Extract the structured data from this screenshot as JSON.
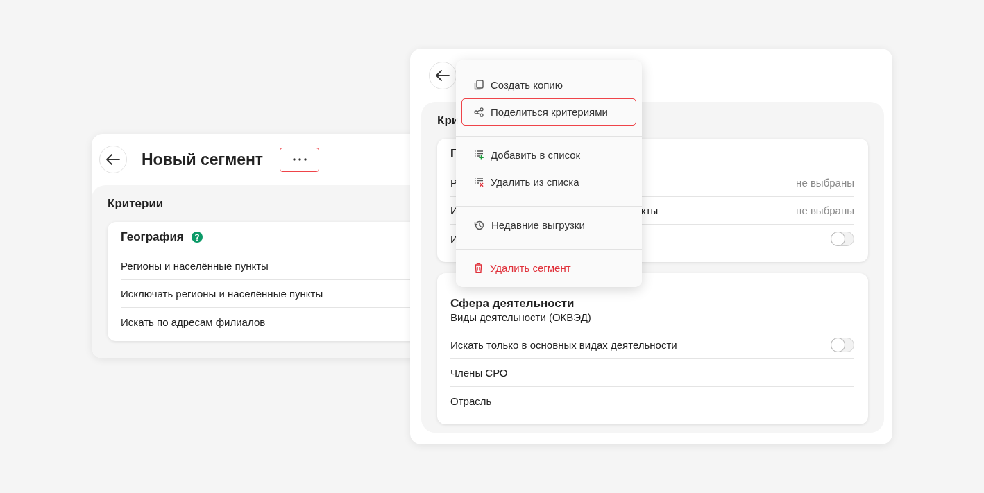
{
  "back_panel": {
    "title": "Новый сегмент",
    "more_button": {
      "highlighted": true
    },
    "section_title": "Критерии",
    "card": {
      "title": "География",
      "rows": [
        "Регионы и населённые пункты",
        "Исключать регионы и населённые пункты",
        "Искать по адресам филиалов"
      ]
    }
  },
  "front_panel": {
    "section_title": "Кри",
    "cards": [
      {
        "title": "Г",
        "rows": [
          {
            "kind": "value",
            "label": "Р",
            "value": "не выбраны"
          },
          {
            "kind": "value",
            "label": "И",
            "label_tail": "кты",
            "value": "не выбраны"
          },
          {
            "kind": "toggle",
            "label": "И",
            "on": false
          }
        ]
      },
      {
        "title": "Сфера деятельности",
        "rows": [
          {
            "kind": "plain",
            "label": "Виды деятельности (ОКВЭД)"
          },
          {
            "kind": "toggle",
            "label": "Искать только в основных видах деятельности",
            "on": false
          },
          {
            "kind": "plain",
            "label": "Члены СРО"
          },
          {
            "kind": "plain",
            "label": "Отрасль"
          }
        ]
      }
    ]
  },
  "menu": {
    "groups": [
      [
        {
          "kind": "copy",
          "label": "Создать копию",
          "highlighted": false,
          "danger": false
        },
        {
          "kind": "share",
          "label": "Поделиться критериями",
          "highlighted": true,
          "danger": false
        }
      ],
      [
        {
          "kind": "add",
          "label": "Добавить в список",
          "highlighted": false,
          "danger": false
        },
        {
          "kind": "remove",
          "label": "Удалить из списка",
          "highlighted": false,
          "danger": false
        }
      ],
      [
        {
          "kind": "history",
          "label": "Недавние выгрузки",
          "highlighted": false,
          "danger": false
        }
      ],
      [
        {
          "kind": "delete",
          "label": "Удалить сегмент",
          "highlighted": false,
          "danger": true
        }
      ]
    ]
  }
}
